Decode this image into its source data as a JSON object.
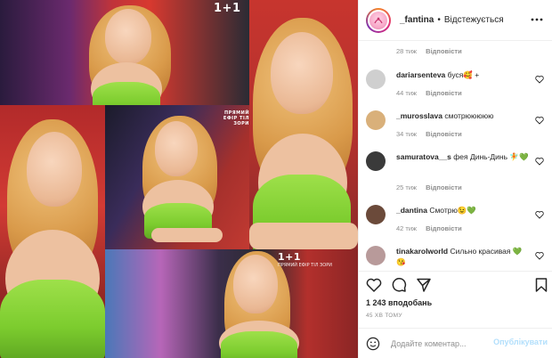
{
  "colors": {
    "text_primary": "#262626",
    "text_secondary": "#8e8e8e",
    "divider": "#efefef",
    "publish_disabled": "#b2dffc",
    "dress_green": "#8fd63d",
    "chair_red": "#c7352e"
  },
  "media": {
    "tiles": [
      {
        "name": "photo-tile-1",
        "brand": "1+1",
        "brand_sub": ""
      },
      {
        "name": "photo-tile-2",
        "brand": "",
        "brand_sub": ""
      },
      {
        "name": "photo-tile-3",
        "brand": "",
        "brand_sub": "ПРЯМИЙ ЕФІР ТІЛ ЗОРИ"
      },
      {
        "name": "photo-tile-4",
        "brand": "",
        "brand_sub": "ПРЯМИЙ ЕФІР ТІЛ ЗОРИ"
      },
      {
        "name": "photo-tile-5",
        "brand": "1+1",
        "brand_sub": "ПРЯМИЙ ЕФІР ТІЛ ЗОРИ"
      }
    ]
  },
  "header": {
    "username": "_fantina",
    "separator": "•",
    "follow_status": "Відстежується",
    "more_icon": "more-horizontal-icon"
  },
  "comments": {
    "top_meta": {
      "time": "28 тиж",
      "reply": "Відповісти"
    },
    "items": [
      {
        "username": "dariarsenteva",
        "text": "буся🥰 +",
        "time": "44 тиж",
        "reply": "Відповісти",
        "avatar_color": "#c9c9c9"
      },
      {
        "username": "_murosslava",
        "text": "смотрююююю",
        "time": "34 тиж",
        "reply": "Відповісти",
        "avatar_color": "#d9b07a"
      },
      {
        "username": "samuratova__s",
        "text": "фея Динь-Динь 🧚💚",
        "time": "25 тиж",
        "reply": "Відповісти",
        "avatar_color": "#3a3a3a"
      },
      {
        "username": "_dantina",
        "text": "Смотрю😉💚",
        "time": "42 тиж",
        "reply": "Відповісти",
        "avatar_color": "#6b4a3a"
      },
      {
        "username": "tinakarolworld",
        "text": "Сильно красивая 💚😘",
        "time": "",
        "reply": "",
        "avatar_color": "#b89a9a"
      }
    ]
  },
  "actions": {
    "like_icon": "heart-icon",
    "comment_icon": "comment-icon",
    "share_icon": "share-icon",
    "save_icon": "bookmark-icon",
    "likes": "1 243 вподобань",
    "posted": "45 ХВ ТОМУ"
  },
  "composer": {
    "emoji_icon": "smiley-icon",
    "placeholder": "Додайте коментар...",
    "publish_label": "Опублікувати"
  }
}
